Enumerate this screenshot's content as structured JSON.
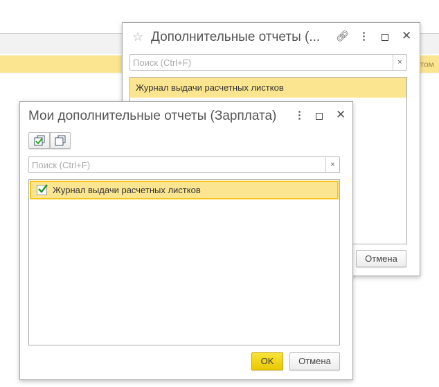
{
  "background": {
    "truncated_text": "нтом"
  },
  "back_dialog": {
    "title": "Дополнительные отчеты (...",
    "search_placeholder": "Поиск (Ctrl+F)",
    "clear": "×",
    "items": [
      "Журнал выдачи расчетных листков"
    ],
    "cancel_label": "Отмена"
  },
  "front_dialog": {
    "title": "Мои дополнительные отчеты (Зарплата)",
    "search_placeholder": "Поиск (Ctrl+F)",
    "clear": "×",
    "items": [
      {
        "label": "Журнал выдачи расчетных листков",
        "checked": true
      }
    ],
    "ok_label": "OK",
    "cancel_label": "Отмена"
  },
  "colors": {
    "selection": "#fbe590",
    "ok_button": "#f0d400"
  }
}
